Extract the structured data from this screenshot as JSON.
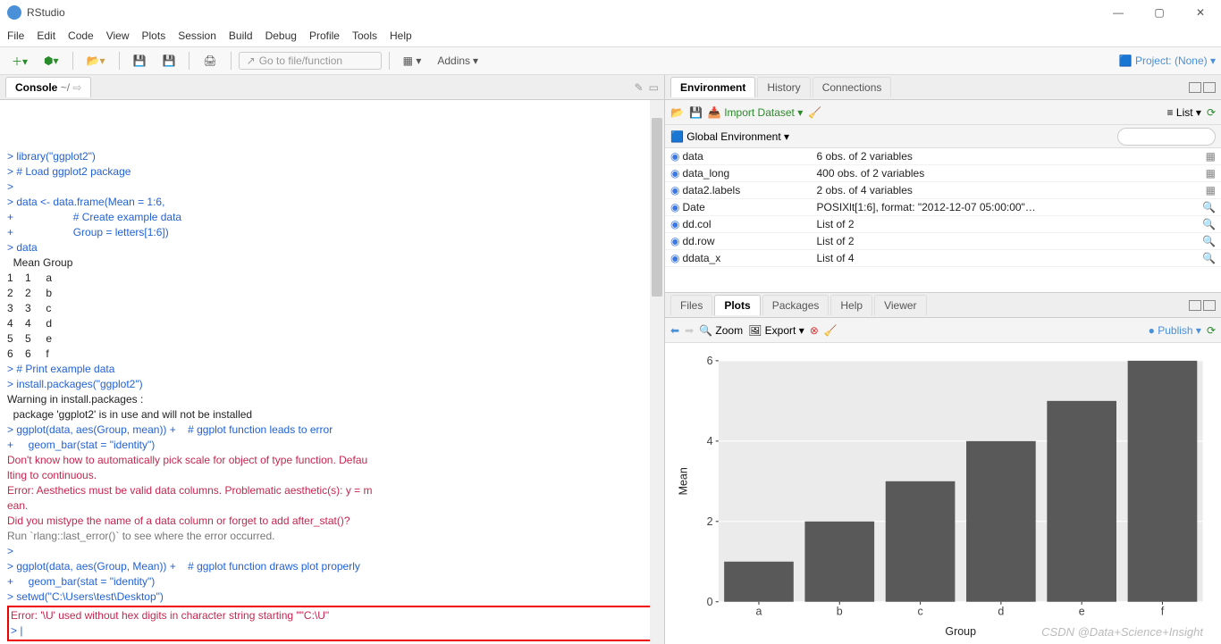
{
  "window": {
    "title": "RStudio"
  },
  "menu": [
    "File",
    "Edit",
    "Code",
    "View",
    "Plots",
    "Session",
    "Build",
    "Debug",
    "Profile",
    "Tools",
    "Help"
  ],
  "toolbar": {
    "goto_placeholder": "Go to file/function",
    "addins": "Addins",
    "project": "Project: (None)"
  },
  "console": {
    "tab": "Console",
    "cwd": "~/",
    "lines": [
      {
        "c": "p",
        "t": "> library(\"ggplot2\")"
      },
      {
        "c": "p",
        "t": "> # Load ggplot2 package"
      },
      {
        "c": "p",
        "t": "> "
      },
      {
        "c": "p",
        "t": "> data <- data.frame(Mean = 1:6,"
      },
      {
        "c": "p",
        "t": "+                    # Create example data"
      },
      {
        "c": "p",
        "t": "+                    Group = letters[1:6])"
      },
      {
        "c": "p",
        "t": "> data"
      },
      {
        "c": "o",
        "t": "  Mean Group"
      },
      {
        "c": "o",
        "t": "1    1     a"
      },
      {
        "c": "o",
        "t": "2    2     b"
      },
      {
        "c": "o",
        "t": "3    3     c"
      },
      {
        "c": "o",
        "t": "4    4     d"
      },
      {
        "c": "o",
        "t": "5    5     e"
      },
      {
        "c": "o",
        "t": "6    6     f"
      },
      {
        "c": "p",
        "t": "> # Print example data"
      },
      {
        "c": "p",
        "t": "> install.packages(\"ggplot2\")"
      },
      {
        "c": "o",
        "t": "Warning in install.packages :"
      },
      {
        "c": "o",
        "t": "  package 'ggplot2' is in use and will not be installed"
      },
      {
        "c": "p",
        "t": "> ggplot(data, aes(Group, mean)) +    # ggplot function leads to error"
      },
      {
        "c": "p",
        "t": "+     geom_bar(stat = \"identity\")"
      },
      {
        "c": "e",
        "t": "Don't know how to automatically pick scale for object of type function. Defau\nlting to continuous."
      },
      {
        "c": "e",
        "t": "Error: Aesthetics must be valid data columns. Problematic aesthetic(s): y = m\nean."
      },
      {
        "c": "e",
        "t": "Did you mistype the name of a data column or forget to add after_stat()?"
      },
      {
        "c": "g",
        "t": "Run `rlang::last_error()` to see where the error occurred."
      },
      {
        "c": "p",
        "t": "> "
      },
      {
        "c": "p",
        "t": "> ggplot(data, aes(Group, Mean)) +    # ggplot function draws plot properly"
      },
      {
        "c": "p",
        "t": "+     geom_bar(stat = \"identity\")"
      },
      {
        "c": "p",
        "t": "> setwd(\"C:\\Users\\test\\Desktop\")"
      }
    ],
    "boxed_error": "Error: '\\U' used without hex digits in character string starting \"\"C:\\U\"",
    "cursor": "> |"
  },
  "env": {
    "tabs": [
      "Environment",
      "History",
      "Connections"
    ],
    "import": "Import Dataset",
    "scope": "Global Environment",
    "view": "List",
    "search_placeholder": "",
    "rows": [
      {
        "k": "data",
        "v": "6 obs. of 2 variables",
        "icon": "grid"
      },
      {
        "k": "data_long",
        "v": "400 obs. of 2 variables",
        "icon": "grid"
      },
      {
        "k": "data2.labels",
        "v": "2 obs. of 4 variables",
        "icon": "grid"
      },
      {
        "k": "Date",
        "v": "POSIXlt[1:6], format: \"2012-12-07 05:00:00\"…",
        "icon": "mag"
      },
      {
        "k": "dd.col",
        "v": "List of 2",
        "icon": "mag"
      },
      {
        "k": "dd.row",
        "v": "List of 2",
        "icon": "mag"
      },
      {
        "k": "ddata_x",
        "v": "List of 4",
        "icon": "mag"
      }
    ]
  },
  "plots": {
    "tabs": [
      "Files",
      "Plots",
      "Packages",
      "Help",
      "Viewer"
    ],
    "zoom": "Zoom",
    "export": "Export",
    "publish": "Publish"
  },
  "chart_data": {
    "type": "bar",
    "categories": [
      "a",
      "b",
      "c",
      "d",
      "e",
      "f"
    ],
    "values": [
      1,
      2,
      3,
      4,
      5,
      6
    ],
    "xlabel": "Group",
    "ylabel": "Mean",
    "ylim": [
      0,
      6
    ],
    "yticks": [
      0,
      2,
      4,
      6
    ]
  },
  "watermark": "CSDN @Data+Science+Insight"
}
